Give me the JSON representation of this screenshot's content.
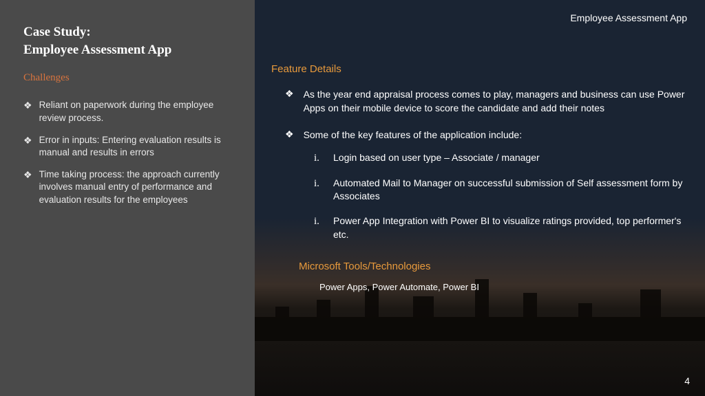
{
  "sidebar": {
    "title_line1": "Case Study:",
    "title_line2": "Employee Assessment App",
    "challenges_heading": "Challenges",
    "challenges": [
      "Reliant on paperwork during the employee review process.",
      "Error in inputs: Entering evaluation results is manual and results in errors",
      "Time taking process: the approach currently involves manual entry of performance and evaluation results for the employees"
    ]
  },
  "main": {
    "header_label": "Employee Assessment App",
    "feature_heading": "Feature Details",
    "features": [
      "As the year end appraisal process comes to play, managers and business can use Power Apps on their mobile device to score the candidate and add their notes",
      "Some of the key features of the application include:"
    ],
    "sub_features": [
      "Login based on user type – Associate / manager",
      "Automated Mail to Manager on successful submission of Self assessment form by Associates",
      "Power App Integration with Power BI to visualize ratings provided, top performer's etc."
    ],
    "roman_marker": "i.",
    "tools_heading": "Microsoft Tools/Technologies",
    "tools_text": "Power Apps, Power Automate, Power BI",
    "page_number": "4"
  },
  "bullet_glyph": "❖"
}
